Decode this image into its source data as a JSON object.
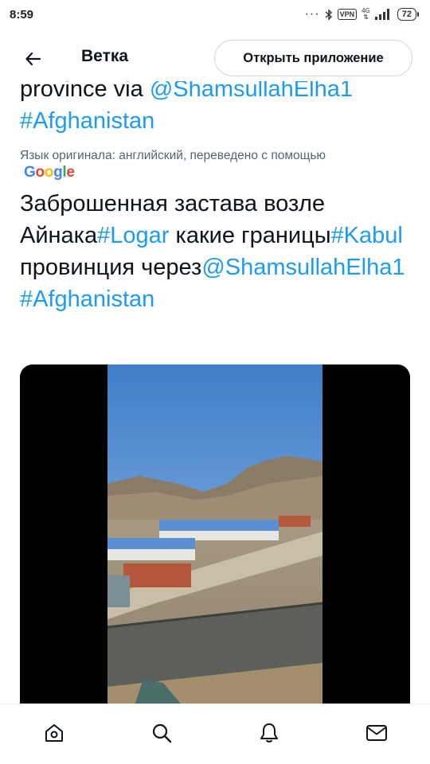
{
  "status_bar": {
    "time": "8:59",
    "dots": "···",
    "vpn": "VPN",
    "network": "4G",
    "battery": "72"
  },
  "header": {
    "title": "Ветка",
    "open_app_button": "Открыть приложение",
    "back_icon": "arrow-left-icon"
  },
  "tweet": {
    "original_fragments": [
      {
        "text": "province via ",
        "link": false
      },
      {
        "text": "@ShamsullahElha1",
        "link": true
      },
      {
        "text": "#Afghanistan",
        "link": true
      }
    ],
    "translation_note": "Язык оригинала: английский, переведено с помощью",
    "translator": "Google",
    "translated_fragments": [
      {
        "text": "Заброшенная застава возле Айнака",
        "link": false
      },
      {
        "text": "#Logar",
        "link": true
      },
      {
        "text": " какие границы",
        "link": false
      },
      {
        "text": "#Kabul",
        "link": true
      },
      {
        "text": " провинция через",
        "link": false
      },
      {
        "text": "@ShamsullahElha1",
        "link": true
      },
      {
        "text": "#Afghanistan",
        "link": true
      }
    ]
  },
  "media": {
    "type": "video",
    "scene": "mountains-prefab-buildings-wall"
  },
  "bottom_nav": {
    "items": [
      {
        "name": "home",
        "icon": "home-icon"
      },
      {
        "name": "search",
        "icon": "search-icon"
      },
      {
        "name": "notifications",
        "icon": "bell-icon"
      },
      {
        "name": "messages",
        "icon": "mail-icon"
      }
    ]
  },
  "colors": {
    "link": "#1d9bf0",
    "text": "#0f1419",
    "muted": "#536471",
    "border": "#cfd9de"
  }
}
